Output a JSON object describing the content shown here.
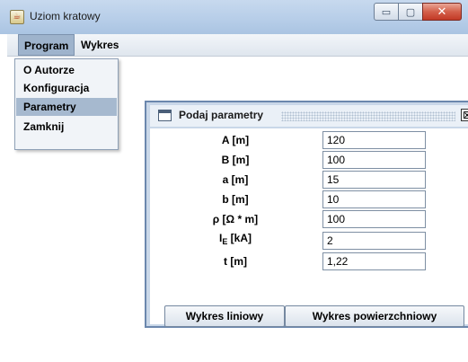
{
  "window": {
    "title": "Uziom kratowy",
    "app_icon": "java-icon",
    "min_glyph": "▭",
    "max_glyph": "▢",
    "close_glyph": "✕"
  },
  "menubar": {
    "items": [
      "Program",
      "Wykres"
    ],
    "active": "Program"
  },
  "program_menu": {
    "items": [
      "O Autorze",
      "Konfiguracja",
      "Parametry",
      "Zamknij"
    ],
    "selected": "Parametry"
  },
  "dialog": {
    "title": "Podaj parametry",
    "close_glyph": "⊠",
    "params": [
      {
        "label": "A [m]",
        "value": "120"
      },
      {
        "label": "B [m]",
        "value": "100"
      },
      {
        "label": "a [m]",
        "value": "15"
      },
      {
        "label": "b [m]",
        "value": "10"
      },
      {
        "label": "ρ [Ω * m]",
        "value": "100"
      },
      {
        "label_main": "I",
        "label_sub": "E",
        "label_rest": " [kA]",
        "value": "2"
      },
      {
        "label": "t [m]",
        "value": "1,22"
      }
    ],
    "buttons": {
      "line_chart": "Wykres liniowy",
      "surface_chart": "Wykres powierzchniowy"
    }
  },
  "colors": {
    "title_bar": "#b6cde8",
    "frame_border": "#6b87ad",
    "menu_selected": "#a6b9cf",
    "close_red": "#c23a26"
  }
}
